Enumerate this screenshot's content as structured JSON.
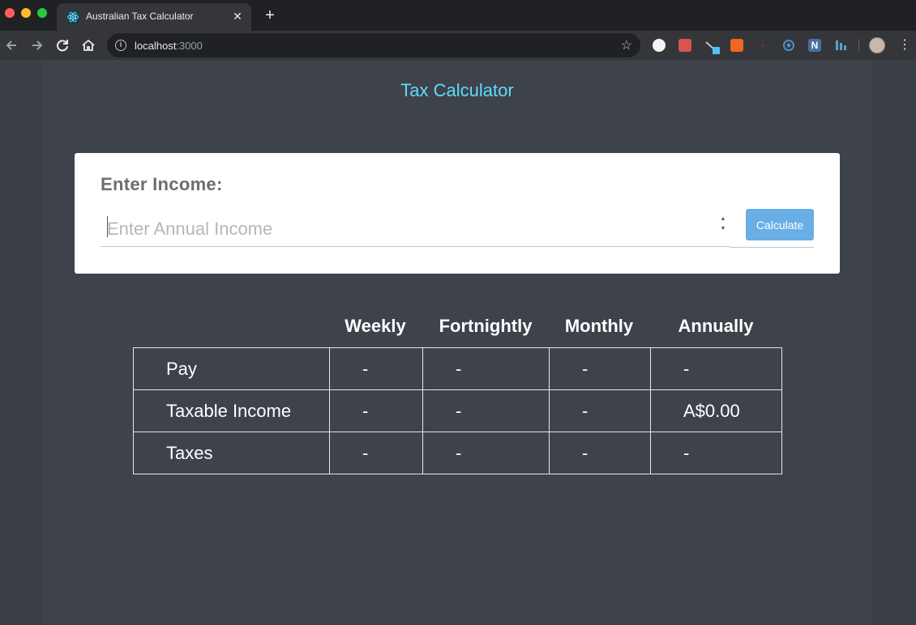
{
  "browser": {
    "tab_title": "Australian Tax Calculator",
    "tab_close": "✕",
    "new_tab": "+",
    "url_host": "localhost",
    "url_port": ":3000",
    "icons": {
      "back": "arrow-left-icon",
      "forward": "arrow-right-icon",
      "reload": "reload-icon",
      "home": "home-icon",
      "bookmark": "star-icon",
      "menu": "kebab-menu-icon"
    }
  },
  "app": {
    "title": "Tax Calculator",
    "title_color": "#61dafb",
    "income_label": "Enter Income:",
    "income_placeholder": "Enter Annual Income",
    "income_value": "",
    "calculate_label": "Calculate",
    "button_color": "#6aaee6"
  },
  "table": {
    "columns": [
      "Weekly",
      "Fortnightly",
      "Monthly",
      "Annually"
    ],
    "rows": [
      {
        "label": "Pay",
        "values": [
          "-",
          "-",
          "-",
          "-"
        ]
      },
      {
        "label": "Taxable Income",
        "values": [
          "-",
          "-",
          "-",
          "A$0.00"
        ]
      },
      {
        "label": "Taxes",
        "values": [
          "-",
          "-",
          "-",
          "-"
        ]
      }
    ]
  }
}
